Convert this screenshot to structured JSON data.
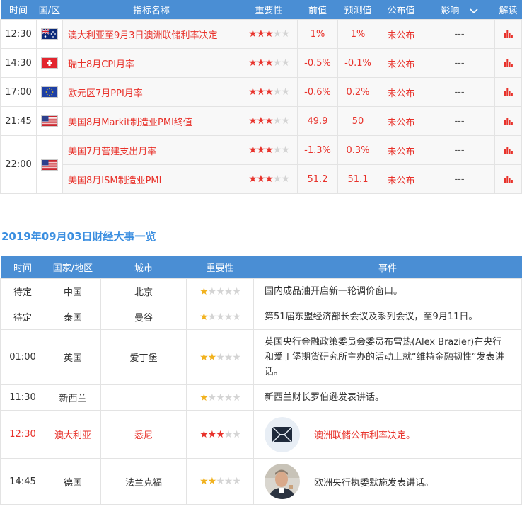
{
  "top_table": {
    "headers": {
      "time": "时间",
      "country": "国/区",
      "indicator": "指标名称",
      "importance": "重要性",
      "previous": "前值",
      "forecast": "预测值",
      "actual": "公布值",
      "impact": "影响",
      "interpret": "解读"
    },
    "rows": [
      {
        "time": "12:30",
        "flag": "australia-flag",
        "name": "澳大利亚至9月3日澳洲联储利率决定",
        "stars": 3,
        "previous": "1%",
        "forecast": "1%",
        "actual": "未公布",
        "impact": "---"
      },
      {
        "time": "14:30",
        "flag": "switzerland-flag",
        "name": "瑞士8月CPI月率",
        "stars": 3,
        "previous": "-0.5%",
        "forecast": "-0.1%",
        "actual": "未公布",
        "impact": "---"
      },
      {
        "time": "17:00",
        "flag": "eu-flag",
        "name": "欧元区7月PPI月率",
        "stars": 3,
        "previous": "-0.6%",
        "forecast": "0.2%",
        "actual": "未公布",
        "impact": "---"
      },
      {
        "time": "21:45",
        "flag": "us-flag",
        "name": "美国8月Markit制造业PMI终值",
        "stars": 3,
        "previous": "49.9",
        "forecast": "50",
        "actual": "未公布",
        "impact": "---"
      },
      {
        "time": "22:00",
        "flag": "us-flag",
        "name": "美国7月营建支出月率",
        "stars": 3,
        "previous": "-1.3%",
        "forecast": "0.3%",
        "actual": "未公布",
        "impact": "---"
      },
      {
        "time": "",
        "flag": "",
        "name": "美国8月ISM制造业PMI",
        "stars": 3,
        "previous": "51.2",
        "forecast": "51.1",
        "actual": "未公布",
        "impact": "---"
      }
    ]
  },
  "section_title": "2019年09月03日财经大事一览",
  "events_table": {
    "headers": {
      "time": "时间",
      "country": "国家/地区",
      "city": "城市",
      "importance": "重要性",
      "event": "事件"
    },
    "rows": [
      {
        "time": "待定",
        "country": "中国",
        "city": "北京",
        "stars": 1,
        "event": "国内成品油开启新一轮调价窗口。"
      },
      {
        "time": "待定",
        "country": "泰国",
        "city": "曼谷",
        "stars": 1,
        "event": "第51届东盟经济部长会议及系列会议，至9月11日。"
      },
      {
        "time": "01:00",
        "country": "英国",
        "city": "爱丁堡",
        "stars": 2,
        "event": "英国央行金融政策委员会委员布雷热(Alex Brazier)在央行和爱丁堡期货研究所主办的活动上就“维持金融韧性”发表讲话。"
      },
      {
        "time": "11:30",
        "country": "新西兰",
        "city": "",
        "stars": 1,
        "event": "新西兰财长罗伯逊发表讲话。"
      },
      {
        "time": "12:30",
        "country": "澳大利亚",
        "city": "悉尼",
        "stars": 3,
        "event": "澳洲联储公布利率决定。",
        "highlight": true,
        "icon": "rba-logo"
      },
      {
        "time": "14:45",
        "country": "德国",
        "city": "法兰克福",
        "stars": 2,
        "event": "欧洲央行执委默施发表讲话。",
        "icon": "speaker-photo"
      }
    ]
  },
  "colors": {
    "header_bg": "#4a8ed4",
    "accent_red": "#e8322b",
    "title_blue": "#3a8ee0",
    "star_yellow": "#f1b21f"
  }
}
